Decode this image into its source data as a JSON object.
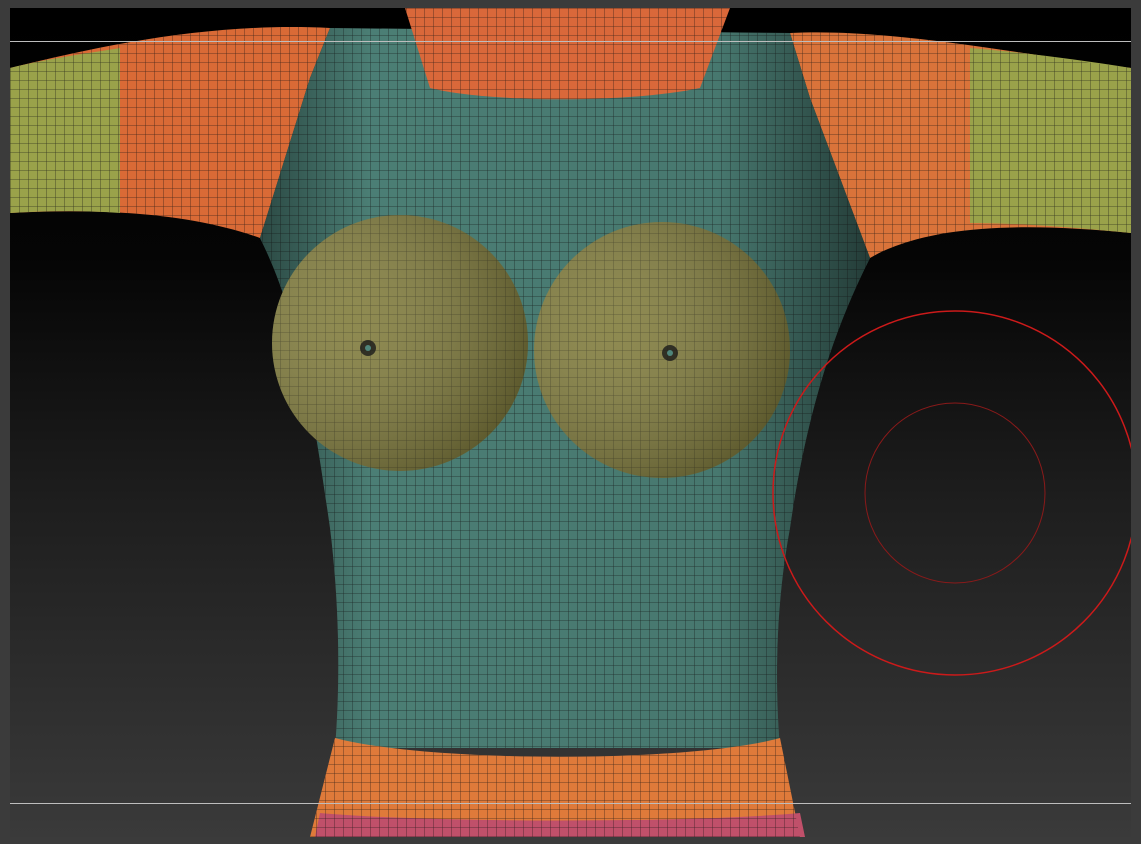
{
  "app": {
    "mode": "3d-sculpt-viewport"
  },
  "viewport": {
    "background_top": "#000000",
    "background_bottom": "#3a3a3a"
  },
  "model": {
    "subject": "torso-mesh-with-polygroups",
    "polygroup_colors": {
      "sleeves": "#e0713a",
      "arms_tip": "#9aa64a",
      "chest": "#4f8a80",
      "breast_discs": "#8a8a3a",
      "waist_band": "#e07a3a",
      "hip": "#c0506a"
    },
    "wireframe_color": "#1a1a1a"
  },
  "brush": {
    "outer_color": "#cc1a1a",
    "inner_color": "#8a1a1a"
  }
}
